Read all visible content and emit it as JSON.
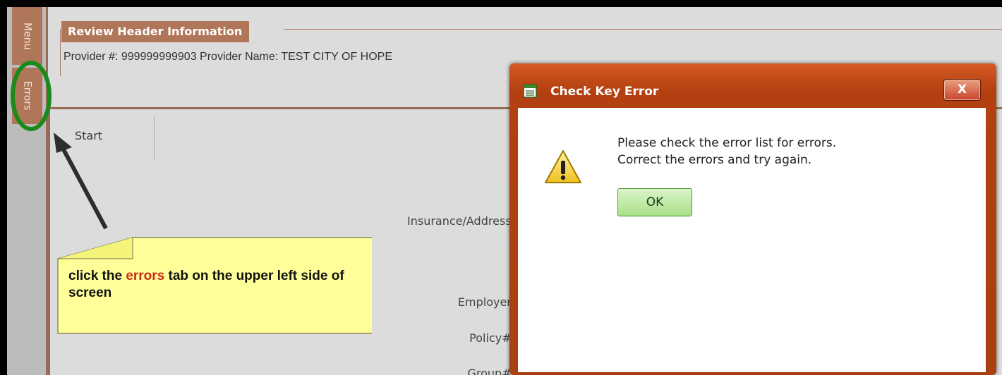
{
  "sidebar": {
    "menu_tab": "Menu",
    "errors_tab": "Errors"
  },
  "header": {
    "section_title": "Review Header Information",
    "provider_line": "Provider #: 999999999903 Provider Name: TEST CITY OF HOPE"
  },
  "form": {
    "start_tab": "Start",
    "fields": {
      "insurance_address": "Insurance/Address:",
      "employer": "Employer:",
      "policy": "Policy#:",
      "group": "Group#:"
    }
  },
  "annotation": {
    "text_before": "click the ",
    "highlight": "errors",
    "text_after": " tab on the upper left side of screen",
    "highlight_color": "#cc2a1a",
    "circle_color": "#1a8a1a"
  },
  "dialog": {
    "title": "Check Key Error",
    "close_label": "X",
    "message_line1": "Please check the error list for errors.",
    "message_line2": "Correct the errors and try again.",
    "ok_label": "OK",
    "icons": {
      "app": "form-window-icon",
      "warning": "warning-triangle-icon",
      "close": "close-icon"
    },
    "title_bar_color": "#b34010"
  },
  "theme": {
    "accent": "#b07659",
    "sidebar_bg": "#bcbcbc",
    "content_bg": "#dcdcdc"
  }
}
